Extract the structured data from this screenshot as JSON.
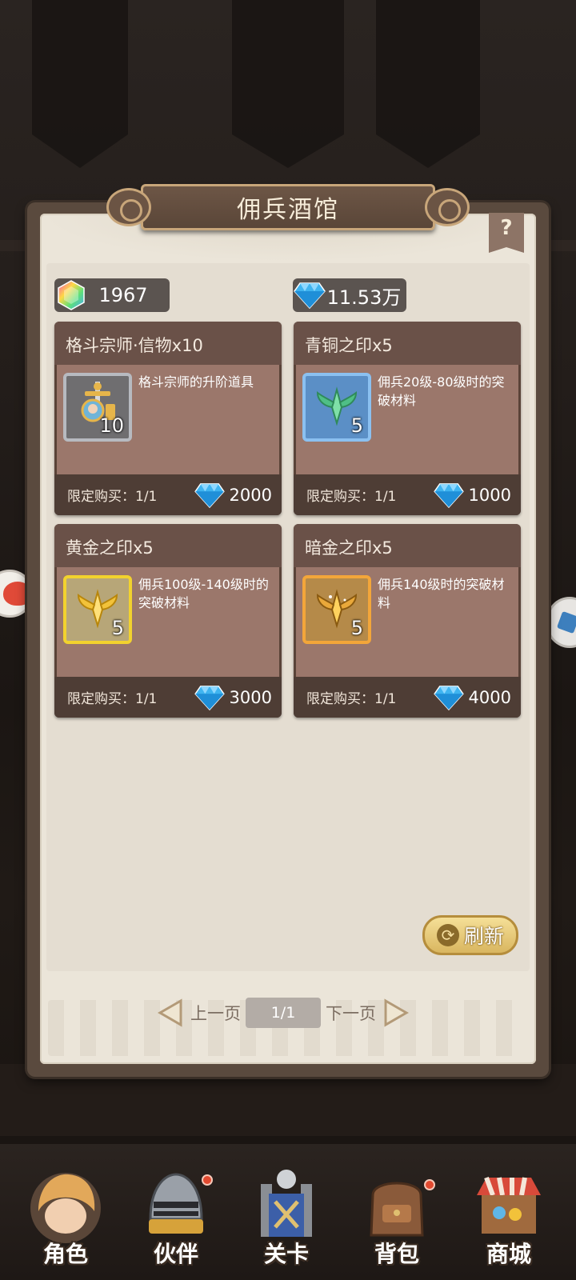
{
  "title": "佣兵酒馆",
  "help": "?",
  "currency": {
    "gem_value": "1967",
    "diamond_value": "11.53万"
  },
  "items": [
    {
      "name": "格斗宗师·信物x10",
      "desc": "格斗宗师的升阶道具",
      "qty": "10",
      "limit": "限定购买：1/1",
      "price": "2000",
      "frame": "grey",
      "icon": "sword-emblem-icon"
    },
    {
      "name": "青铜之印x5",
      "desc": "佣兵20级-80级时的突破材料",
      "qty": "5",
      "limit": "限定购买：1/1",
      "price": "1000",
      "frame": "blue",
      "icon": "green-crest-icon"
    },
    {
      "name": "黄金之印x5",
      "desc": "佣兵100级-140级时的突破材料",
      "qty": "5",
      "limit": "限定购买：1/1",
      "price": "3000",
      "frame": "gold",
      "icon": "gold-crest-icon"
    },
    {
      "name": "暗金之印x5",
      "desc": "佣兵140级时的突破材料",
      "qty": "5",
      "limit": "限定购买：1/1",
      "price": "4000",
      "frame": "orange",
      "icon": "dark-gold-crest-icon"
    }
  ],
  "refresh_label": "刷新",
  "pager": {
    "prev": "上一页",
    "page": "1/1",
    "next": "下一页"
  },
  "nav": [
    {
      "label": "角色",
      "icon": "character-icon"
    },
    {
      "label": "伙伴",
      "icon": "knight-helmet-icon"
    },
    {
      "label": "关卡",
      "icon": "stage-gate-icon"
    },
    {
      "label": "背包",
      "icon": "backpack-icon"
    },
    {
      "label": "商城",
      "icon": "shop-stall-icon"
    }
  ],
  "colors": {
    "panel": "#ebe5d9",
    "card_body": "#9b776b",
    "card_head": "#6a5148",
    "diamond": "#3fb4f0",
    "gold": "#e8c560"
  }
}
